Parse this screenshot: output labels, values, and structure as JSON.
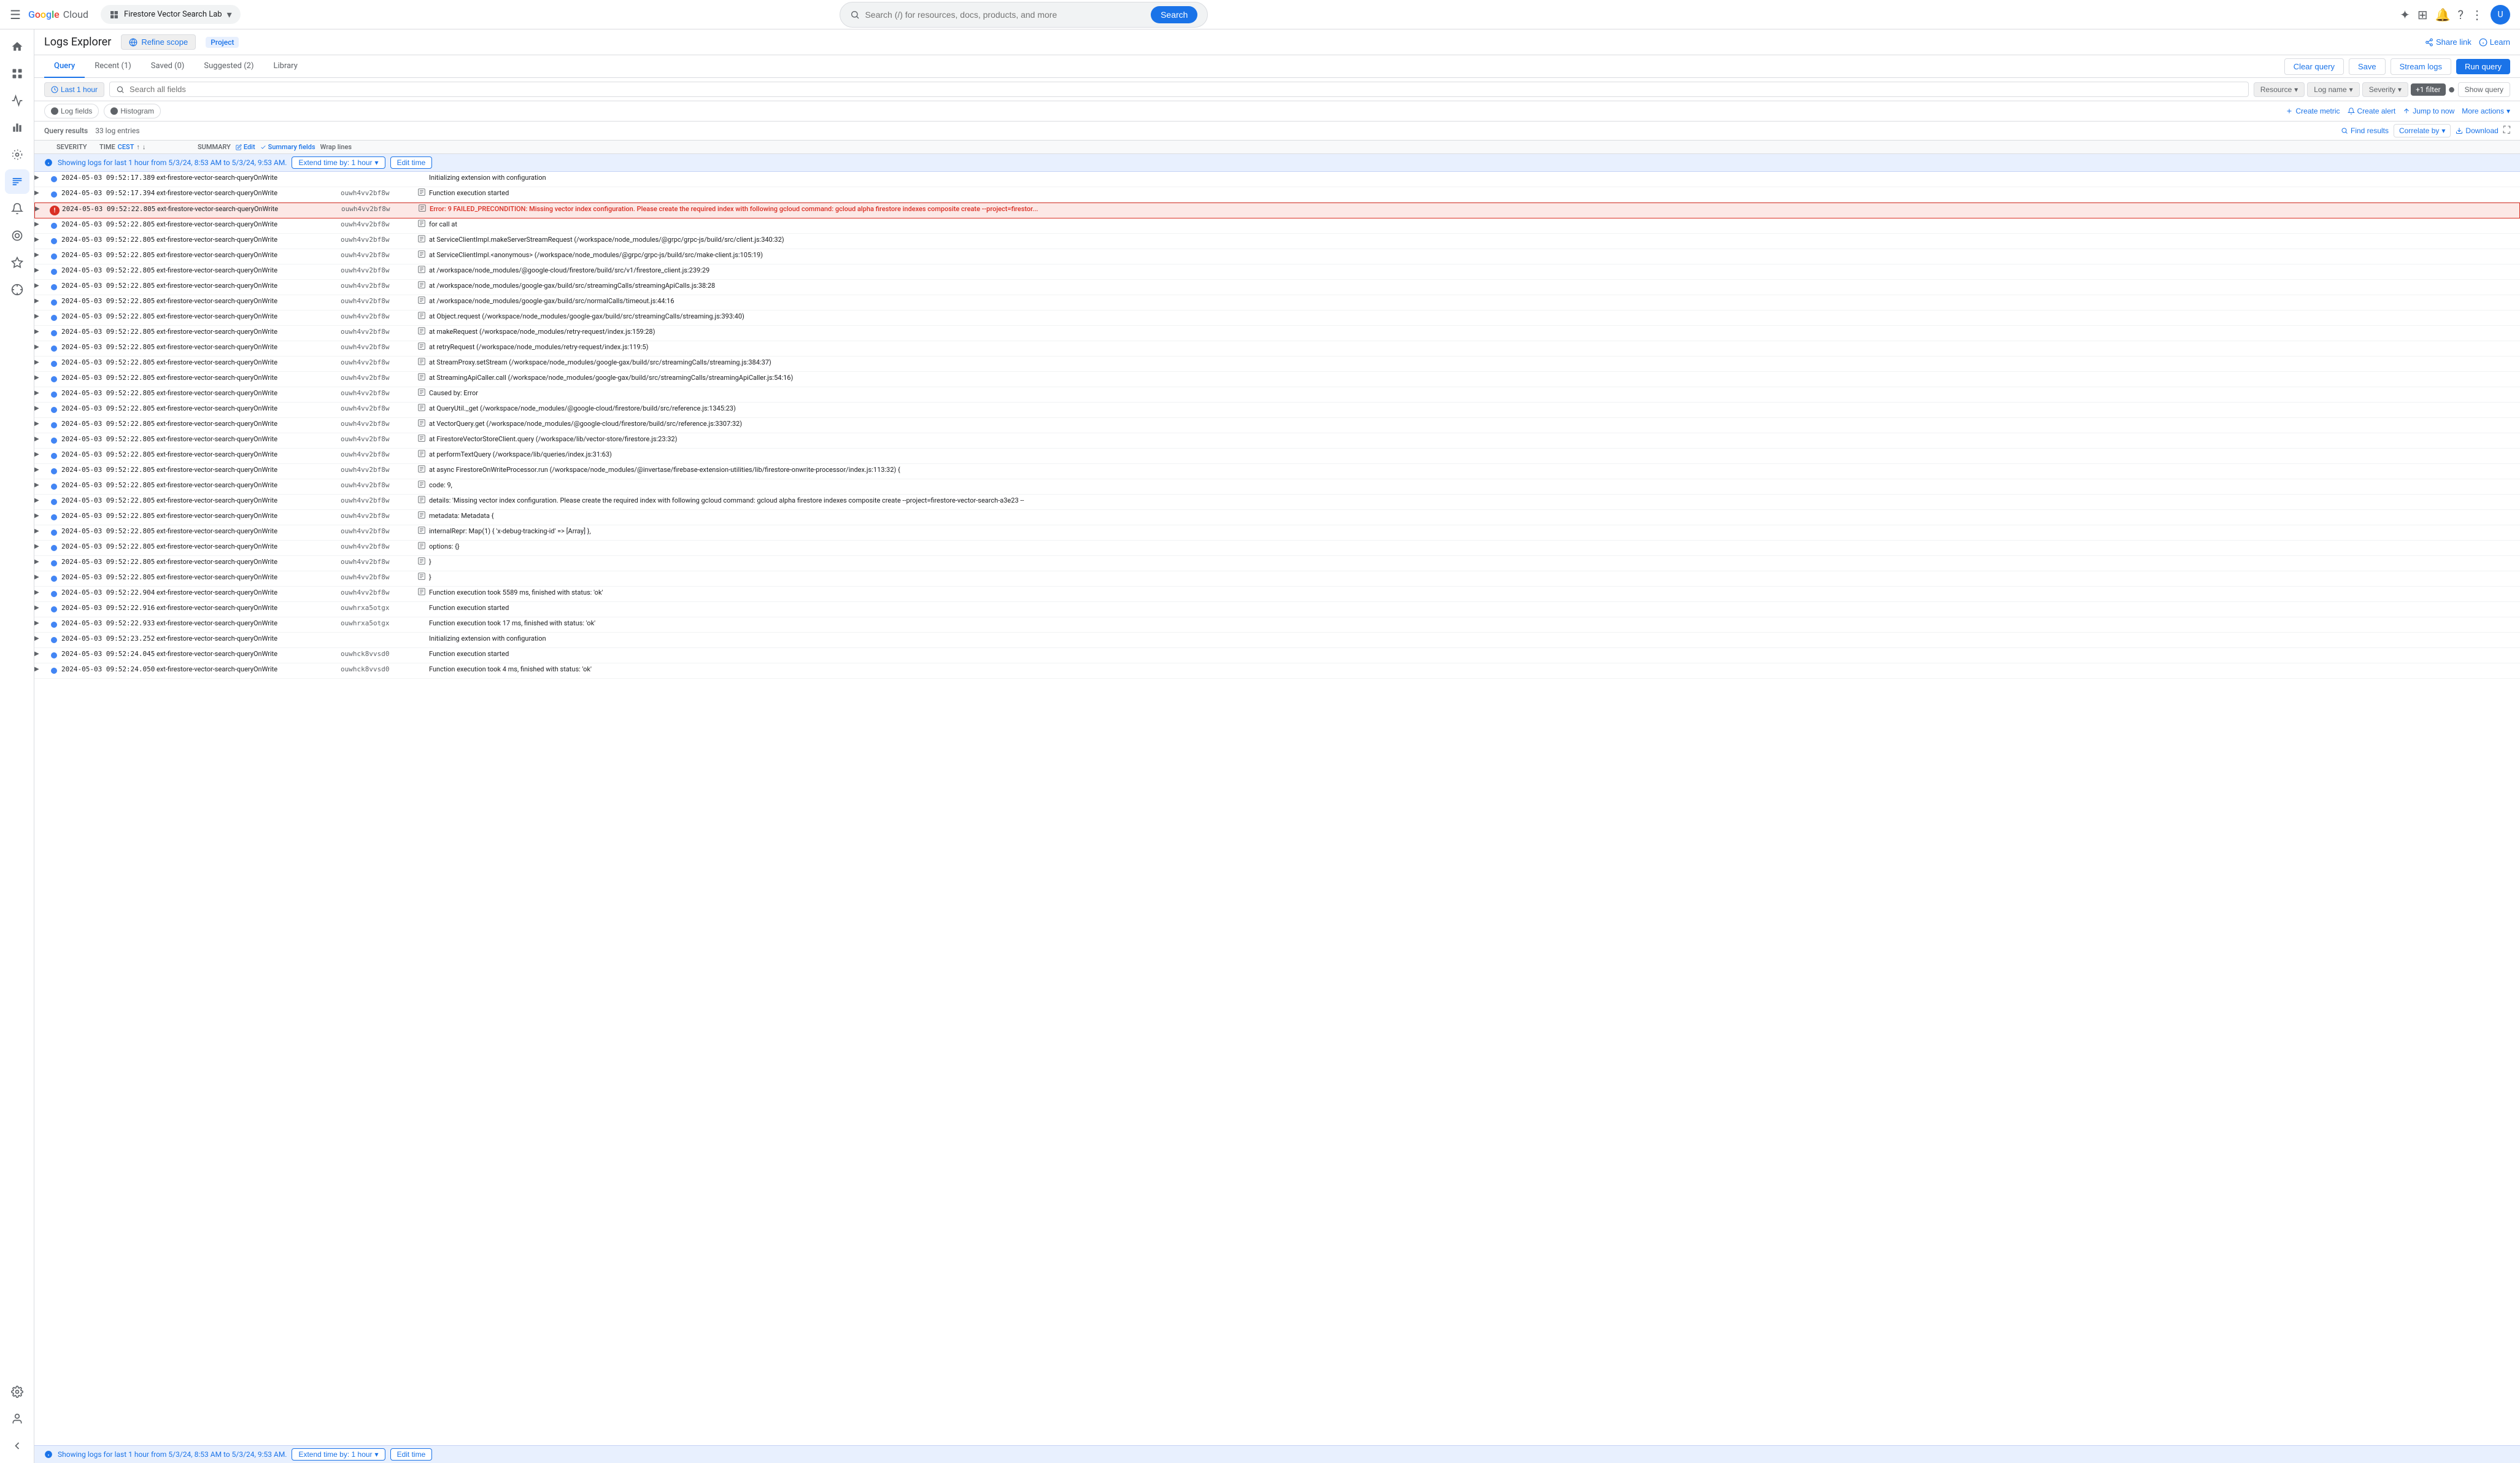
{
  "topnav": {
    "hamburger": "☰",
    "logo_google": "Google",
    "logo_cloud": "Cloud",
    "project_name": "Firestore Vector Search Lab",
    "search_placeholder": "Search (/) for resources, docs, products, and more",
    "search_label": "Search"
  },
  "header": {
    "title": "Logs Explorer",
    "refine_scope": "Refine scope",
    "project_chip": "Project",
    "share_link": "Share link",
    "learn": "Learn"
  },
  "tabs": {
    "items": [
      "Query",
      "Recent (1)",
      "Saved (0)",
      "Suggested (2)",
      "Library"
    ],
    "active": "Query"
  },
  "toolbar": {
    "clear_query": "Clear query",
    "save": "Save",
    "stream_logs": "Stream logs",
    "run_query": "Run query"
  },
  "query_bar": {
    "time_btn": "Last 1 hour",
    "search_placeholder": "Search all fields",
    "resource_label": "Resource",
    "log_name_label": "Log name",
    "severity_label": "Severity",
    "plus1_filter": "+1 filter",
    "filter_circle": "●",
    "show_query": "Show query"
  },
  "view_toolbar": {
    "log_fields": "Log fields",
    "histogram": "Histogram",
    "create_metric": "Create metric",
    "create_alert": "Create alert",
    "jump_to_now": "Jump to now",
    "more_actions": "More actions"
  },
  "results_bar": {
    "label": "Query results",
    "count": "33 log entries",
    "find_results": "Find results",
    "correlate_by": "Correlate by",
    "download": "Download",
    "expand_icon": "⛶"
  },
  "col_headers": {
    "severity": "SEVERITY",
    "time": "TIME",
    "time_sort": "CEST",
    "summary": "SUMMARY",
    "edit": "Edit",
    "summary_fields": "Summary fields",
    "wrap_lines": "Wrap lines"
  },
  "info_bar": {
    "text": "Showing logs for last 1 hour from 5/3/24, 8:53 AM to 5/3/24, 9:53 AM.",
    "extend_btn": "Extend time by: 1 hour",
    "edit_time": "Edit time"
  },
  "log_rows": [
    {
      "id": "r1",
      "sev": "info",
      "time": "2024-05-03  09:52:17.389",
      "function": "ext-firestore-vector-search-queryOnWrite",
      "exec_id": "",
      "has_stack": false,
      "message": "Initializing extension with configuration"
    },
    {
      "id": "r2",
      "sev": "info",
      "time": "2024-05-03  09:52:17.394",
      "function": "ext-firestore-vector-search-queryOnWrite",
      "exec_id": "ouwh4vv2bf8w",
      "has_stack": true,
      "message": "Function execution started"
    },
    {
      "id": "r3",
      "sev": "error",
      "time": "2024-05-03  09:52:22.805",
      "function": "ext-firestore-vector-search-queryOnWrite",
      "exec_id": "ouwh4vv2bf8w",
      "has_stack": true,
      "message": "Error: 9 FAILED_PRECONDITION: Missing vector index configuration. Please create the required index with following gcloud command: gcloud alpha firestore indexes composite create --project=firestor...",
      "highlighted": true
    },
    {
      "id": "r4",
      "sev": "info",
      "time": "2024-05-03  09:52:22.805",
      "function": "ext-firestore-vector-search-queryOnWrite",
      "exec_id": "ouwh4vv2bf8w",
      "has_stack": true,
      "message": "    for call at"
    },
    {
      "id": "r5",
      "sev": "info",
      "time": "2024-05-03  09:52:22.805",
      "function": "ext-firestore-vector-search-queryOnWrite",
      "exec_id": "ouwh4vv2bf8w",
      "has_stack": true,
      "message": "    at ServiceClientImpl.makeServerStreamRequest (/workspace/node_modules/@grpc/grpc-js/build/src/client.js:340:32)"
    },
    {
      "id": "r6",
      "sev": "info",
      "time": "2024-05-03  09:52:22.805",
      "function": "ext-firestore-vector-search-queryOnWrite",
      "exec_id": "ouwh4vv2bf8w",
      "has_stack": true,
      "message": "    at ServiceClientImpl.<anonymous> (/workspace/node_modules/@grpc/grpc-js/build/src/make-client.js:105:19)"
    },
    {
      "id": "r7",
      "sev": "info",
      "time": "2024-05-03  09:52:22.805",
      "function": "ext-firestore-vector-search-queryOnWrite",
      "exec_id": "ouwh4vv2bf8w",
      "has_stack": true,
      "message": "    at /workspace/node_modules/@google-cloud/firestore/build/src/v1/firestore_client.js:239:29"
    },
    {
      "id": "r8",
      "sev": "info",
      "time": "2024-05-03  09:52:22.805",
      "function": "ext-firestore-vector-search-queryOnWrite",
      "exec_id": "ouwh4vv2bf8w",
      "has_stack": true,
      "message": "    at /workspace/node_modules/google-gax/build/src/streamingCalls/streamingApiCalls.js:38:28"
    },
    {
      "id": "r9",
      "sev": "info",
      "time": "2024-05-03  09:52:22.805",
      "function": "ext-firestore-vector-search-queryOnWrite",
      "exec_id": "ouwh4vv2bf8w",
      "has_stack": true,
      "message": "    at /workspace/node_modules/google-gax/build/src/normalCalls/timeout.js:44:16"
    },
    {
      "id": "r10",
      "sev": "info",
      "time": "2024-05-03  09:52:22.805",
      "function": "ext-firestore-vector-search-queryOnWrite",
      "exec_id": "ouwh4vv2bf8w",
      "has_stack": true,
      "message": "    at Object.request (/workspace/node_modules/google-gax/build/src/streamingCalls/streaming.js:393:40)"
    },
    {
      "id": "r11",
      "sev": "info",
      "time": "2024-05-03  09:52:22.805",
      "function": "ext-firestore-vector-search-queryOnWrite",
      "exec_id": "ouwh4vv2bf8w",
      "has_stack": true,
      "message": "    at makeRequest (/workspace/node_modules/retry-request/index.js:159:28)"
    },
    {
      "id": "r12",
      "sev": "info",
      "time": "2024-05-03  09:52:22.805",
      "function": "ext-firestore-vector-search-queryOnWrite",
      "exec_id": "ouwh4vv2bf8w",
      "has_stack": true,
      "message": "    at retryRequest (/workspace/node_modules/retry-request/index.js:119:5)"
    },
    {
      "id": "r13",
      "sev": "info",
      "time": "2024-05-03  09:52:22.805",
      "function": "ext-firestore-vector-search-queryOnWrite",
      "exec_id": "ouwh4vv2bf8w",
      "has_stack": true,
      "message": "    at StreamProxy.setStream (/workspace/node_modules/google-gax/build/src/streamingCalls/streaming.js:384:37)"
    },
    {
      "id": "r14",
      "sev": "info",
      "time": "2024-05-03  09:52:22.805",
      "function": "ext-firestore-vector-search-queryOnWrite",
      "exec_id": "ouwh4vv2bf8w",
      "has_stack": true,
      "message": "    at StreamingApiCaller.call (/workspace/node_modules/google-gax/build/src/streamingCalls/streamingApiCaller.js:54:16)"
    },
    {
      "id": "r15",
      "sev": "info",
      "time": "2024-05-03  09:52:22.805",
      "function": "ext-firestore-vector-search-queryOnWrite",
      "exec_id": "ouwh4vv2bf8w",
      "has_stack": true,
      "message": "Caused by: Error"
    },
    {
      "id": "r16",
      "sev": "info",
      "time": "2024-05-03  09:52:22.805",
      "function": "ext-firestore-vector-search-queryOnWrite",
      "exec_id": "ouwh4vv2bf8w",
      "has_stack": true,
      "message": "    at QueryUtil._get (/workspace/node_modules/@google-cloud/firestore/build/src/reference.js:1345:23)"
    },
    {
      "id": "r17",
      "sev": "info",
      "time": "2024-05-03  09:52:22.805",
      "function": "ext-firestore-vector-search-queryOnWrite",
      "exec_id": "ouwh4vv2bf8w",
      "has_stack": true,
      "message": "    at VectorQuery.get (/workspace/node_modules/@google-cloud/firestore/build/src/reference.js:3307:32)"
    },
    {
      "id": "r18",
      "sev": "info",
      "time": "2024-05-03  09:52:22.805",
      "function": "ext-firestore-vector-search-queryOnWrite",
      "exec_id": "ouwh4vv2bf8w",
      "has_stack": true,
      "message": "    at FirestoreVectorStoreClient.query (/workspace/lib/vector-store/firestore.js:23:32)"
    },
    {
      "id": "r19",
      "sev": "info",
      "time": "2024-05-03  09:52:22.805",
      "function": "ext-firestore-vector-search-queryOnWrite",
      "exec_id": "ouwh4vv2bf8w",
      "has_stack": true,
      "message": "    at performTextQuery (/workspace/lib/queries/index.js:31:63)"
    },
    {
      "id": "r20",
      "sev": "info",
      "time": "2024-05-03  09:52:22.805",
      "function": "ext-firestore-vector-search-queryOnWrite",
      "exec_id": "ouwh4vv2bf8w",
      "has_stack": true,
      "message": "    at async FirestoreOnWriteProcessor.run (/workspace/node_modules/@invertase/firebase-extension-utilities/lib/firestore-onwrite-processor/index.js:113:32) {"
    },
    {
      "id": "r21",
      "sev": "info",
      "time": "2024-05-03  09:52:22.805",
      "function": "ext-firestore-vector-search-queryOnWrite",
      "exec_id": "ouwh4vv2bf8w",
      "has_stack": true,
      "message": "  code: 9,"
    },
    {
      "id": "r22",
      "sev": "info",
      "time": "2024-05-03  09:52:22.805",
      "function": "ext-firestore-vector-search-queryOnWrite",
      "exec_id": "ouwh4vv2bf8w",
      "has_stack": true,
      "message": "  details: 'Missing vector index configuration. Please create the required index with following gcloud command: gcloud alpha firestore indexes composite create --project=firestore-vector-search-a3e23 --"
    },
    {
      "id": "r23",
      "sev": "info",
      "time": "2024-05-03  09:52:22.805",
      "function": "ext-firestore-vector-search-queryOnWrite",
      "exec_id": "ouwh4vv2bf8w",
      "has_stack": true,
      "message": "  metadata: Metadata {"
    },
    {
      "id": "r24",
      "sev": "info",
      "time": "2024-05-03  09:52:22.805",
      "function": "ext-firestore-vector-search-queryOnWrite",
      "exec_id": "ouwh4vv2bf8w",
      "has_stack": true,
      "message": "    internalRepr: Map(1) { 'x-debug-tracking-id' => [Array] },"
    },
    {
      "id": "r25",
      "sev": "info",
      "time": "2024-05-03  09:52:22.805",
      "function": "ext-firestore-vector-search-queryOnWrite",
      "exec_id": "ouwh4vv2bf8w",
      "has_stack": true,
      "message": "    options: {}"
    },
    {
      "id": "r26",
      "sev": "info",
      "time": "2024-05-03  09:52:22.805",
      "function": "ext-firestore-vector-search-queryOnWrite",
      "exec_id": "ouwh4vv2bf8w",
      "has_stack": true,
      "message": "  }"
    },
    {
      "id": "r27",
      "sev": "info",
      "time": "2024-05-03  09:52:22.805",
      "function": "ext-firestore-vector-search-queryOnWrite",
      "exec_id": "ouwh4vv2bf8w",
      "has_stack": true,
      "message": "}"
    },
    {
      "id": "r28",
      "sev": "info",
      "time": "2024-05-03  09:52:22.904",
      "function": "ext-firestore-vector-search-queryOnWrite",
      "exec_id": "ouwh4vv2bf8w",
      "has_stack": true,
      "message": "Function execution took 5589 ms, finished with status: 'ok'"
    },
    {
      "id": "r29",
      "sev": "info",
      "time": "2024-05-03  09:52:22.916",
      "function": "ext-firestore-vector-search-queryOnWrite",
      "exec_id": "ouwhrxa5otgx",
      "has_stack": false,
      "message": "Function execution started"
    },
    {
      "id": "r30",
      "sev": "info",
      "time": "2024-05-03  09:52:22.933",
      "function": "ext-firestore-vector-search-queryOnWrite",
      "exec_id": "ouwhrxa5otgx",
      "has_stack": false,
      "message": "Function execution took 17 ms, finished with status: 'ok'"
    },
    {
      "id": "r31",
      "sev": "info",
      "time": "2024-05-03  09:52:23.252",
      "function": "ext-firestore-vector-search-queryOnWrite",
      "exec_id": "",
      "has_stack": false,
      "message": "Initializing extension with configuration"
    },
    {
      "id": "r32",
      "sev": "info",
      "time": "2024-05-03  09:52:24.045",
      "function": "ext-firestore-vector-search-queryOnWrite",
      "exec_id": "ouwhck8vvsd0",
      "has_stack": false,
      "message": "Function execution started"
    },
    {
      "id": "r33",
      "sev": "info",
      "time": "2024-05-03  09:52:24.050",
      "function": "ext-firestore-vector-search-queryOnWrite",
      "exec_id": "ouwhck8vvsd0",
      "has_stack": false,
      "message": "Function execution took 4 ms, finished with status: 'ok'"
    }
  ],
  "bottom_info": {
    "text": "Showing logs for last 1 hour from 5/3/24, 8:53 AM to 5/3/24, 9:53 AM.",
    "extend_btn": "Extend time by: 1 hour",
    "edit_time": "Edit time"
  },
  "sidebar": {
    "items": [
      {
        "label": "Navigation menu",
        "icon": "☰"
      },
      {
        "label": "Home",
        "icon": "⌂"
      },
      {
        "label": "Dashboard",
        "icon": "▣"
      },
      {
        "label": "Monitoring",
        "icon": "◈"
      },
      {
        "label": "Activity",
        "icon": "◉"
      },
      {
        "label": "Logs",
        "icon": "≡",
        "active": true
      },
      {
        "label": "Alerts",
        "icon": "🔔"
      },
      {
        "label": "Trace",
        "icon": "◎"
      },
      {
        "label": "Debug",
        "icon": "◆"
      },
      {
        "label": "Profiler",
        "icon": "⊕"
      },
      {
        "label": "Settings",
        "icon": "⚙"
      },
      {
        "label": "User",
        "icon": "◐"
      }
    ]
  }
}
